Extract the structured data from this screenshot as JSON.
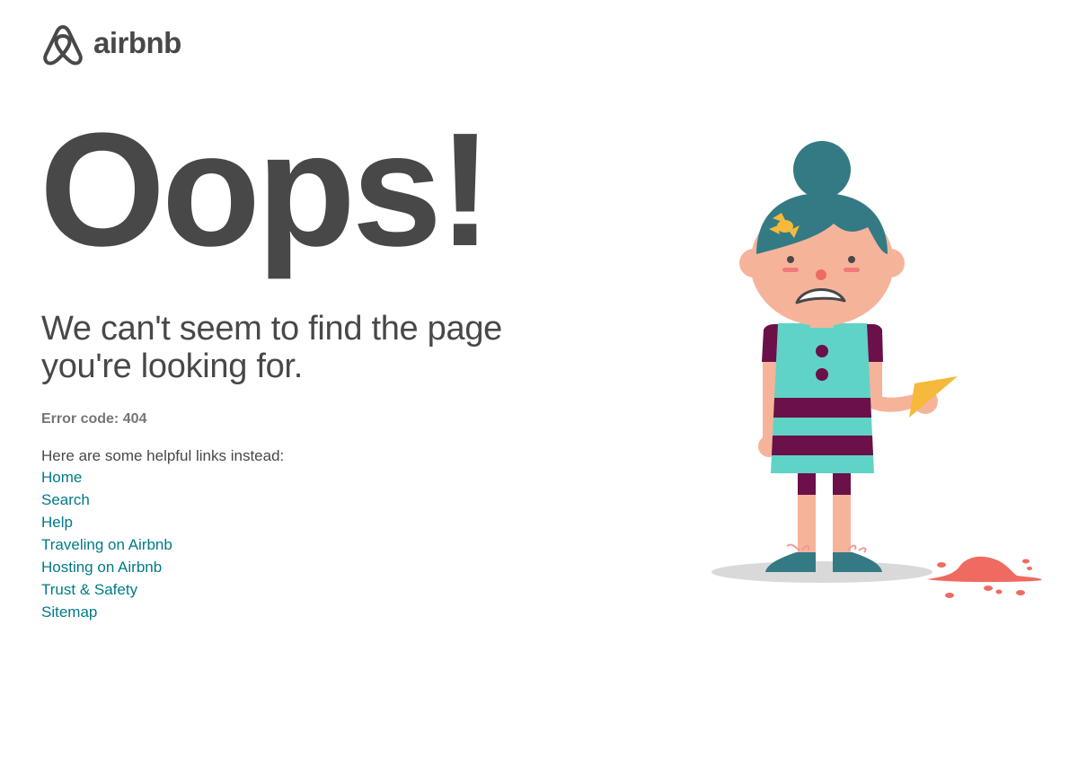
{
  "brand": {
    "name": "airbnb",
    "logo_icon": "airbnb-belo-icon",
    "color": "#484848"
  },
  "main": {
    "headline": "Oops!",
    "message": "We can't seem to find the page you're looking for.",
    "error_code": "Error code: 404",
    "links_intro": "Here are some helpful links instead:",
    "links": [
      {
        "label": "Home"
      },
      {
        "label": "Search"
      },
      {
        "label": "Help"
      },
      {
        "label": "Traveling on Airbnb"
      },
      {
        "label": "Hosting on Airbnb"
      },
      {
        "label": "Trust & Safety"
      },
      {
        "label": "Sitemap"
      }
    ]
  },
  "colors": {
    "text": "#484848",
    "muted": "#767676",
    "link": "#007a87",
    "hair": "#337a85",
    "dress": "#5fd3c6",
    "stripe": "#6b1048",
    "skin": "#f5b49a",
    "ice_cream": "#ef6b62",
    "cone": "#f6b93b"
  },
  "illustration": {
    "icon": "sad-girl-dropped-ice-cream-illustration"
  }
}
